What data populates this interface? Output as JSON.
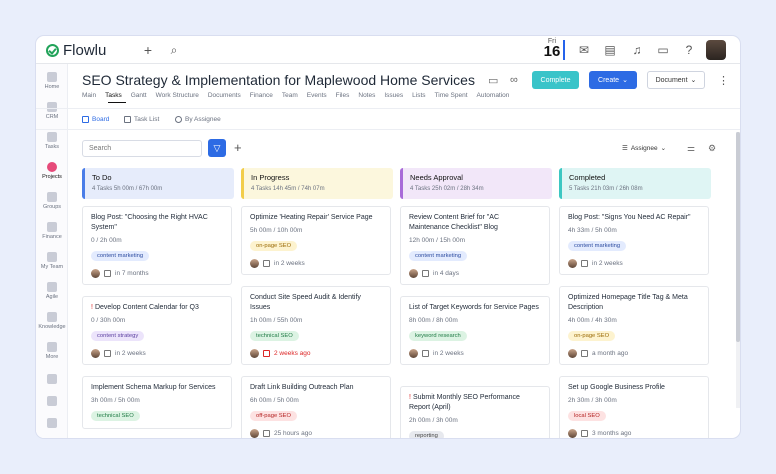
{
  "app": {
    "name": "Flowlu"
  },
  "topbar": {
    "day_of_week": "Fri",
    "day": "16"
  },
  "sidebar": {
    "items": [
      {
        "label": "Home"
      },
      {
        "label": "CRM"
      },
      {
        "label": "Tasks"
      },
      {
        "label": "Projects"
      },
      {
        "label": "Groups"
      },
      {
        "label": "Finance"
      },
      {
        "label": "My Team"
      },
      {
        "label": "Agile"
      },
      {
        "label": "Knowledge"
      },
      {
        "label": "More"
      }
    ]
  },
  "header": {
    "title": "SEO Strategy & Implementation for Maplewood Home Services",
    "complete_label": "Complete",
    "create_label": "Create",
    "document_label": "Document"
  },
  "tabs": [
    "Main",
    "Tasks",
    "Gantt",
    "Work Structure",
    "Documents",
    "Finance",
    "Team",
    "Events",
    "Files",
    "Notes",
    "Issues",
    "Lists",
    "Time Spent",
    "Automation"
  ],
  "views": {
    "board": "Board",
    "task_list": "Task List",
    "by_assignee": "By Assignee"
  },
  "filters": {
    "search_placeholder": "Search",
    "assignee_label": "Assignee"
  },
  "columns": [
    {
      "title": "To Do",
      "meta": "4 Tasks  5h 00m / 67h 00m",
      "color": "#4a7de8",
      "bg": "#e6ecfb",
      "cards": [
        {
          "title": "Blog Post: \"Choosing the Right HVAC System\"",
          "time": "0 / 2h 00m",
          "tag": "content marketing",
          "tag_color": "blue",
          "due": "in 7 months",
          "overdue": false,
          "warn": ""
        },
        {
          "title": "Develop Content Calendar for Q3",
          "time": "0 / 30h 00m",
          "tag": "content strategy",
          "tag_color": "purple",
          "due": "in 2 weeks",
          "overdue": false,
          "warn": "!"
        },
        {
          "title": "Implement Schema Markup for Services",
          "time": "3h 00m / 5h 00m",
          "tag": "technical SEO",
          "tag_color": "green",
          "due": "",
          "overdue": false,
          "warn": ""
        }
      ]
    },
    {
      "title": "In Progress",
      "meta": "4 Tasks  14h 45m / 74h 07m",
      "color": "#f2cd4a",
      "bg": "#fcf7dd",
      "cards": [
        {
          "title": "Optimize 'Heating Repair' Service Page",
          "time": "5h 00m / 10h 00m",
          "tag": "on-page SEO",
          "tag_color": "yellow",
          "due": "in 2 weeks",
          "overdue": false,
          "warn": ""
        },
        {
          "title": "Conduct Site Speed Audit & Identify Issues",
          "time": "1h 00m / 55h 00m",
          "tag": "technical SEO",
          "tag_color": "green",
          "due": "2 weeks ago",
          "overdue": true,
          "warn": ""
        },
        {
          "title": "Draft Link Building Outreach Plan",
          "time": "6h 00m / 5h 00m",
          "tag": "off-page SEO",
          "tag_color": "red",
          "due": "25 hours ago",
          "overdue": false,
          "warn": ""
        }
      ]
    },
    {
      "title": "Needs Approval",
      "meta": "4 Tasks  25h 02m / 28h 34m",
      "color": "#a86ad8",
      "bg": "#f2e7f9",
      "cards": [
        {
          "title": "Review Content Brief for \"AC Maintenance Checklist\" Blog",
          "time": "12h 00m / 15h 00m",
          "tag": "content marketing",
          "tag_color": "blue",
          "due": "in 4 days",
          "overdue": false,
          "warn": ""
        },
        {
          "title": "List of Target Keywords for Service Pages",
          "time": "8h 00m / 8h 00m",
          "tag": "keyword research",
          "tag_color": "green",
          "due": "in 2 weeks",
          "overdue": false,
          "warn": ""
        },
        {
          "title": "Submit Monthly SEO Performance Report (April)",
          "time": "2h 00m / 3h 00m",
          "tag": "reporting",
          "tag_color": "gray",
          "due": "",
          "overdue": false,
          "warn": "!"
        }
      ]
    },
    {
      "title": "Completed",
      "meta": "5 Tasks  21h 03m / 26h 08m",
      "color": "#3cc7c2",
      "bg": "#dff5f4",
      "cards": [
        {
          "title": "Blog Post: \"Signs You Need AC Repair\"",
          "time": "4h 33m / 5h 00m",
          "tag": "content marketing",
          "tag_color": "blue",
          "due": "in 2 weeks",
          "overdue": false,
          "warn": ""
        },
        {
          "title": "Optimized Homepage Title Tag & Meta Description",
          "time": "4h 00m / 4h 30m",
          "tag": "on-page SEO",
          "tag_color": "yellow",
          "due": "a month ago",
          "overdue": false,
          "warn": ""
        },
        {
          "title": "Set up Google Business Profile",
          "time": "2h 30m / 3h 00m",
          "tag": "local SEO",
          "tag_color": "red",
          "due": "3 months ago",
          "overdue": false,
          "warn": ""
        }
      ]
    }
  ]
}
